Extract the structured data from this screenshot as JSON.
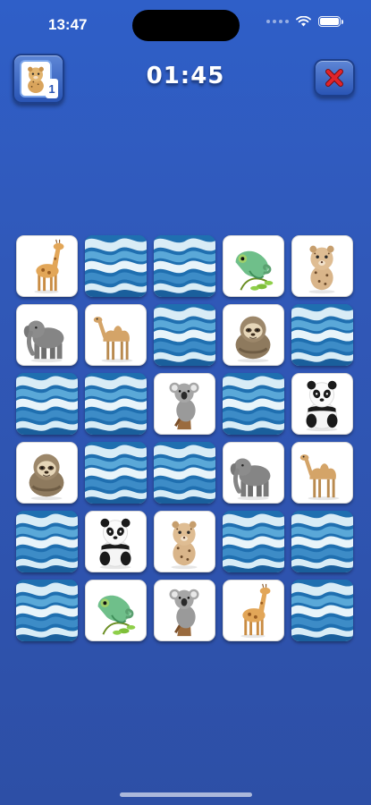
{
  "status_bar": {
    "time": "13:47"
  },
  "top_bar": {
    "timer": "01:45",
    "hint_count": "1"
  },
  "colors": {
    "background": "#2f5fc8",
    "close_x": "#e0242a",
    "wave_dark": "#1f6fb0",
    "wave_light": "#d8ecf6"
  },
  "board": {
    "rows": 6,
    "columns": 5,
    "cards": [
      {
        "state": "face-up",
        "animal": "giraffe"
      },
      {
        "state": "face-down",
        "animal": ""
      },
      {
        "state": "face-down",
        "animal": ""
      },
      {
        "state": "face-up",
        "animal": "chameleon"
      },
      {
        "state": "face-up",
        "animal": "leopard-cub"
      },
      {
        "state": "face-up",
        "animal": "elephant"
      },
      {
        "state": "face-up",
        "animal": "camel"
      },
      {
        "state": "face-down",
        "animal": ""
      },
      {
        "state": "face-up",
        "animal": "sloth"
      },
      {
        "state": "face-down",
        "animal": ""
      },
      {
        "state": "face-down",
        "animal": ""
      },
      {
        "state": "face-down",
        "animal": ""
      },
      {
        "state": "face-up",
        "animal": "koala"
      },
      {
        "state": "face-down",
        "animal": ""
      },
      {
        "state": "face-up",
        "animal": "panda"
      },
      {
        "state": "face-up",
        "animal": "sloth"
      },
      {
        "state": "face-down",
        "animal": ""
      },
      {
        "state": "face-down",
        "animal": ""
      },
      {
        "state": "face-up",
        "animal": "elephant"
      },
      {
        "state": "face-up",
        "animal": "camel"
      },
      {
        "state": "face-down",
        "animal": ""
      },
      {
        "state": "face-up",
        "animal": "panda"
      },
      {
        "state": "face-up",
        "animal": "leopard-cub"
      },
      {
        "state": "face-down",
        "animal": ""
      },
      {
        "state": "face-down",
        "animal": ""
      },
      {
        "state": "face-down",
        "animal": ""
      },
      {
        "state": "face-up",
        "animal": "chameleon"
      },
      {
        "state": "face-up",
        "animal": "koala"
      },
      {
        "state": "face-up",
        "animal": "giraffe"
      },
      {
        "state": "face-down",
        "animal": ""
      }
    ]
  }
}
